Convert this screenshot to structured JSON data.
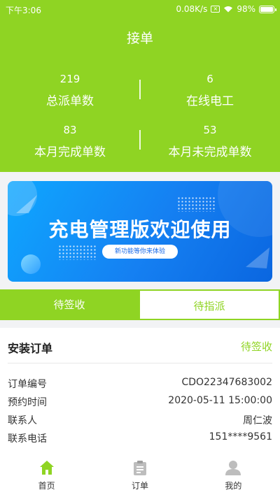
{
  "status_bar": {
    "time": "下午3:06",
    "network_speed": "0.08K/s",
    "battery_percent": "98%"
  },
  "header": {
    "title": "接单"
  },
  "stats": [
    {
      "value": "219",
      "label": "总派单数"
    },
    {
      "value": "6",
      "label": "在线电工"
    },
    {
      "value": "83",
      "label": "本月完成单数"
    },
    {
      "value": "53",
      "label": "本月未完成单数"
    }
  ],
  "banner": {
    "title": "充电管理版欢迎使用",
    "pill_text": "新功能等你来体验"
  },
  "tabs": [
    {
      "label": "待签收",
      "active": true
    },
    {
      "label": "待指派",
      "active": false
    }
  ],
  "order": {
    "title": "安装订单",
    "status": "待签收",
    "fields": [
      {
        "label": "订单编号",
        "value": "CDO22347683002"
      },
      {
        "label": "预约时间",
        "value": "2020-05-11 15:00:00"
      },
      {
        "label": "联系人",
        "value": "周仁波"
      },
      {
        "label": "联系电话",
        "value": "151****9561"
      }
    ]
  },
  "bottom_nav": [
    {
      "label": "首页",
      "icon": "home-icon",
      "active": true
    },
    {
      "label": "订单",
      "icon": "clipboard-icon",
      "active": false
    },
    {
      "label": "我的",
      "icon": "user-icon",
      "active": false
    }
  ],
  "colors": {
    "primary": "#8fd423",
    "banner_blue": "#1580f2",
    "nav_inactive": "#bdbdbd"
  }
}
